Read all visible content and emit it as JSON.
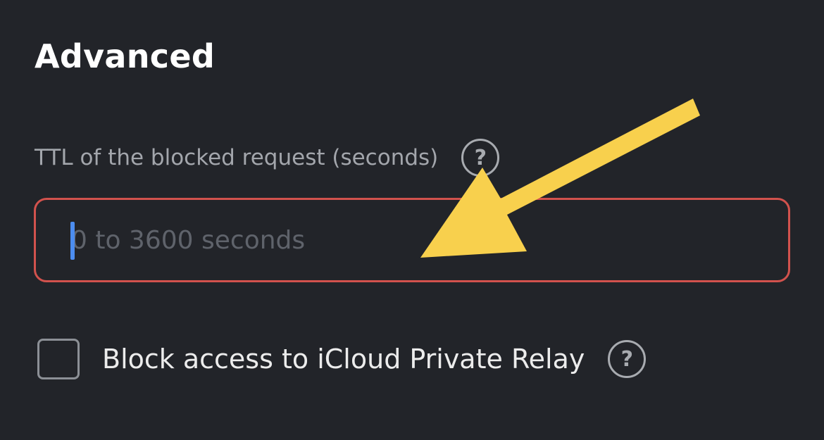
{
  "section": {
    "title": "Advanced"
  },
  "ttl_field": {
    "label": "TTL of the blocked request (seconds)",
    "placeholder": "0 to 3600 seconds",
    "value": "",
    "help_icon": "question-circle-icon",
    "border_color": "#d2524d"
  },
  "icloud_option": {
    "label": "Block access to iCloud Private Relay",
    "checked": false,
    "help_icon": "question-circle-icon"
  },
  "annotation": {
    "icon": "arrow-annotation-icon",
    "color": "#f8d04d"
  },
  "help_glyph": "?"
}
